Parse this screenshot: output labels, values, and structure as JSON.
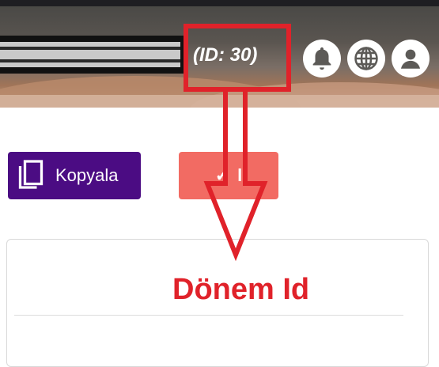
{
  "header": {
    "id_label": "(ID: 30)",
    "icons": [
      "bell-icon",
      "globe-icon",
      "user-icon"
    ]
  },
  "toolbar": {
    "copy_label": "Kopyala",
    "red_button_label": "l"
  },
  "annotation": {
    "text": "Dönem Id",
    "color": "#e0222a"
  },
  "colors": {
    "copy_button": "#4b0c83",
    "red_button": "#f26b63"
  }
}
